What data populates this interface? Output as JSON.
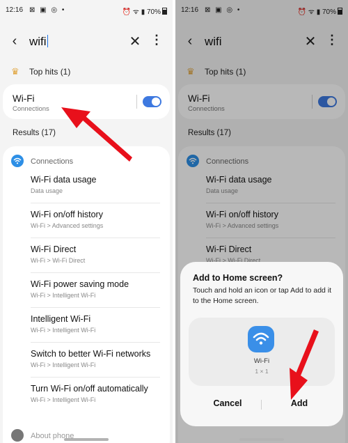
{
  "status": {
    "time": "12:16",
    "battery": "70%"
  },
  "search": {
    "query": "wifi"
  },
  "top_hits_label": "Top hits (1)",
  "wifi_result": {
    "title": "Wi-Fi",
    "subtitle": "Connections",
    "toggle_on": true
  },
  "results_label": "Results (17)",
  "section": {
    "label": "Connections"
  },
  "items": [
    {
      "title": "Wi-Fi data usage",
      "subtitle": "Data usage"
    },
    {
      "title": "Wi-Fi on/off history",
      "subtitle": "Wi-Fi > Advanced settings"
    },
    {
      "title": "Wi-Fi Direct",
      "subtitle": "Wi-Fi > Wi-Fi Direct"
    },
    {
      "title": "Wi-Fi power saving mode",
      "subtitle": "Wi-Fi > Intelligent Wi-Fi"
    },
    {
      "title": "Intelligent Wi-Fi",
      "subtitle": "Wi-Fi > Intelligent Wi-Fi"
    },
    {
      "title": "Switch to better Wi-Fi networks",
      "subtitle": "Wi-Fi > Intelligent Wi-Fi"
    },
    {
      "title": "Turn Wi-Fi on/off automatically",
      "subtitle": "Wi-Fi > Intelligent Wi-Fi"
    }
  ],
  "about_label": "About phone",
  "dialog": {
    "title": "Add to Home screen?",
    "text": "Touch and hold an icon or tap Add to add it to the Home screen.",
    "tile_label": "Wi-Fi",
    "tile_size": "1 × 1",
    "cancel_label": "Cancel",
    "add_label": "Add"
  },
  "colors": {
    "accent": "#3e79e0",
    "arrow": "#e8101b",
    "tile": "#3a8fe8"
  },
  "icons": {
    "back": "back-arrow-icon",
    "clear": "close-icon",
    "more": "more-vert-icon",
    "crown": "crown-icon",
    "wifi": "wifi-icon"
  }
}
